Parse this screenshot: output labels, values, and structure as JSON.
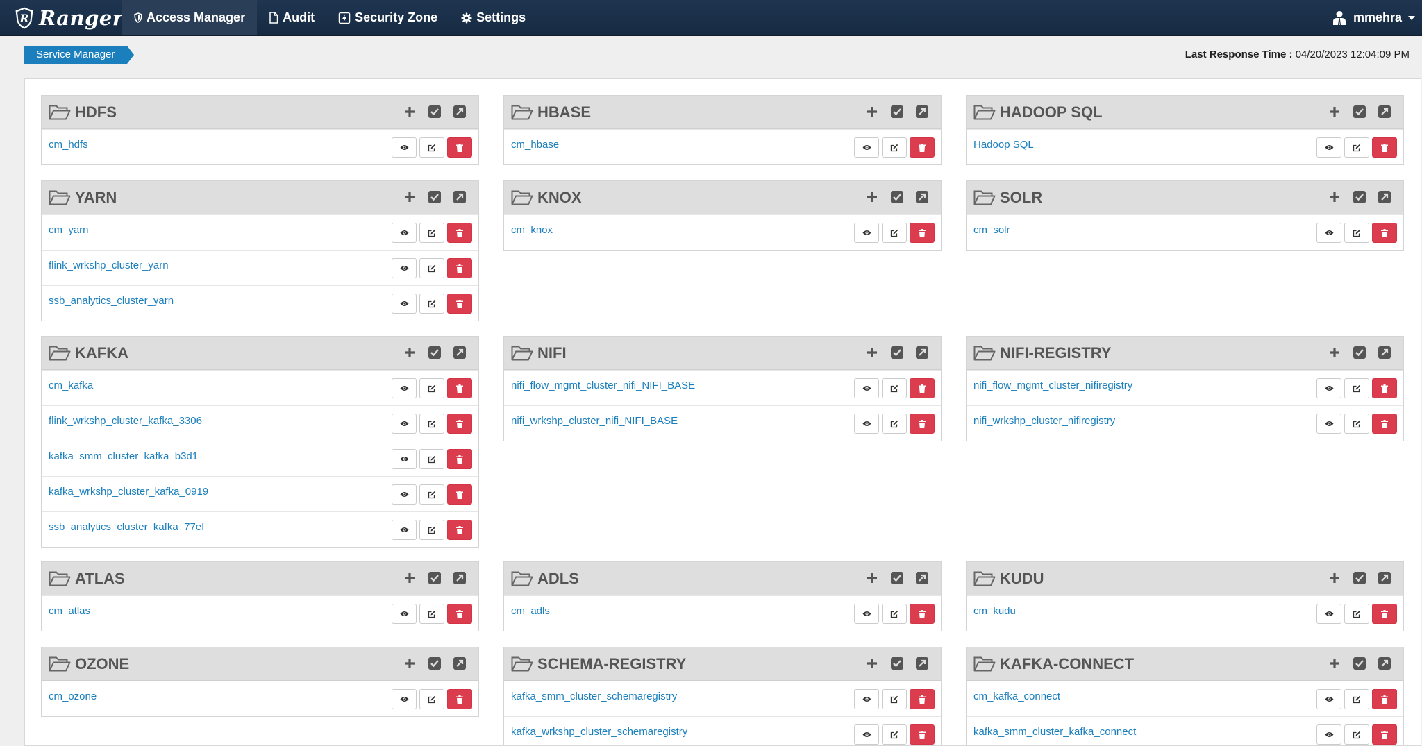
{
  "nav": {
    "brand": "Ranger",
    "items": [
      {
        "label": "Access Manager",
        "icon": "shield-icon"
      },
      {
        "label": "Audit",
        "icon": "file-icon"
      },
      {
        "label": "Security Zone",
        "icon": "zone-icon"
      },
      {
        "label": "Settings",
        "icon": "gear-icon"
      }
    ],
    "user": "mmehra"
  },
  "breadcrumb": "Service Manager",
  "response": {
    "label": "Last Response Time :",
    "value": "04/20/2023 12:04:09 PM"
  },
  "services": [
    {
      "title": "HDFS",
      "items": [
        "cm_hdfs"
      ]
    },
    {
      "title": "HBASE",
      "items": [
        "cm_hbase"
      ]
    },
    {
      "title": "HADOOP SQL",
      "items": [
        "Hadoop SQL"
      ]
    },
    {
      "title": "YARN",
      "items": [
        "cm_yarn",
        "flink_wrkshp_cluster_yarn",
        "ssb_analytics_cluster_yarn"
      ]
    },
    {
      "title": "KNOX",
      "items": [
        "cm_knox"
      ]
    },
    {
      "title": "SOLR",
      "items": [
        "cm_solr"
      ]
    },
    {
      "title": "KAFKA",
      "items": [
        "cm_kafka",
        "flink_wrkshp_cluster_kafka_3306",
        "kafka_smm_cluster_kafka_b3d1",
        "kafka_wrkshp_cluster_kafka_0919",
        "ssb_analytics_cluster_kafka_77ef"
      ]
    },
    {
      "title": "NIFI",
      "items": [
        "nifi_flow_mgmt_cluster_nifi_NIFI_BASE",
        "nifi_wrkshp_cluster_nifi_NIFI_BASE"
      ]
    },
    {
      "title": "NIFI-REGISTRY",
      "items": [
        "nifi_flow_mgmt_cluster_nifiregistry",
        "nifi_wrkshp_cluster_nifiregistry"
      ]
    },
    {
      "title": "ATLAS",
      "items": [
        "cm_atlas"
      ]
    },
    {
      "title": "ADLS",
      "items": [
        "cm_adls"
      ]
    },
    {
      "title": "KUDU",
      "items": [
        "cm_kudu"
      ]
    },
    {
      "title": "OZONE",
      "items": [
        "cm_ozone"
      ]
    },
    {
      "title": "SCHEMA-REGISTRY",
      "items": [
        "kafka_smm_cluster_schemaregistry",
        "kafka_wrkshp_cluster_schemaregistry"
      ]
    },
    {
      "title": "KAFKA-CONNECT",
      "items": [
        "cm_kafka_connect",
        "kafka_smm_cluster_kafka_connect"
      ]
    }
  ]
}
